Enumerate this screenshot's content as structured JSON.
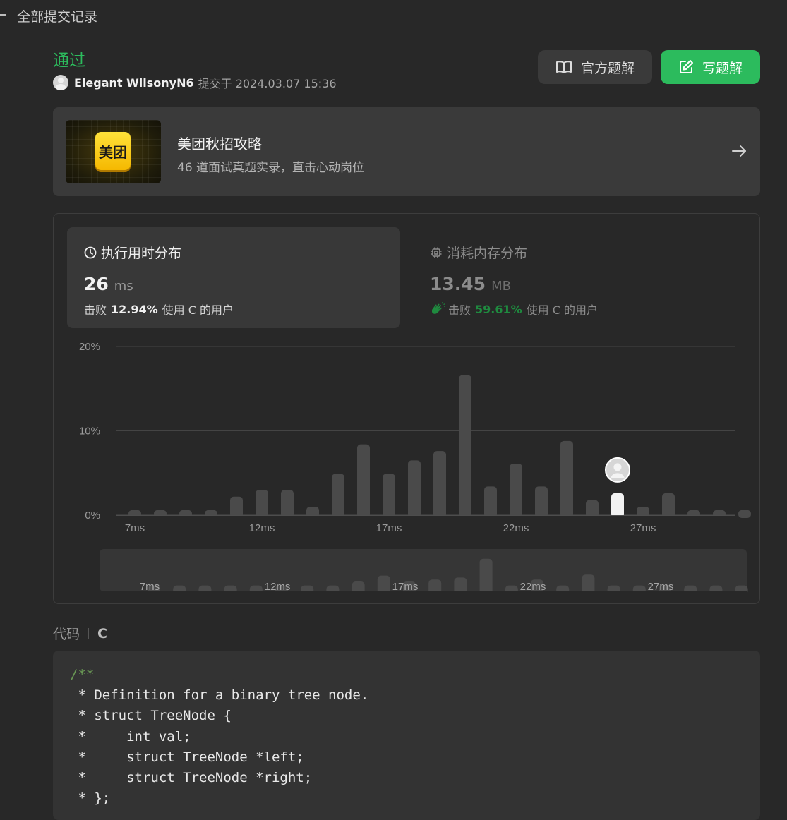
{
  "topbar": {
    "title": "全部提交记录"
  },
  "submission": {
    "status": "通过",
    "username": "Elegant WilsonyN6",
    "submitted_at": "提交于 2024.03.07 15:36"
  },
  "actions": {
    "official_solution": "官方题解",
    "write_solution": "写题解"
  },
  "promo": {
    "logo_text": "美团",
    "title": "美团秋招攻略",
    "subtitle": "46 道面试真题实录，直击心动岗位"
  },
  "runtime": {
    "label": "执行用时分布",
    "value": "26",
    "unit": "ms",
    "beats_prefix": "击败",
    "beats_pct": "12.94%",
    "beats_suffix": "使用 C 的用户"
  },
  "memory": {
    "label": "消耗内存分布",
    "value": "13.45",
    "unit": "MB",
    "beats_prefix": "击败",
    "beats_pct": "59.61%",
    "beats_suffix": "使用 C 的用户"
  },
  "chart_data": {
    "type": "bar",
    "x": [
      7,
      8,
      9,
      10,
      11,
      12,
      13,
      14,
      15,
      16,
      17,
      18,
      19,
      20,
      21,
      22,
      23,
      24,
      25,
      26,
      27,
      28,
      29,
      30,
      31
    ],
    "values": [
      0.6,
      0.6,
      0.6,
      0.6,
      2.2,
      3.0,
      3.0,
      1.0,
      4.9,
      8.4,
      4.9,
      6.5,
      7.6,
      16.6,
      3.4,
      6.1,
      3.4,
      8.8,
      1.8,
      2.6,
      1.0,
      2.6,
      0.6,
      0.6,
      0.6
    ],
    "x_ticks": [
      "7ms",
      "12ms",
      "17ms",
      "22ms",
      "27ms"
    ],
    "y_ticks": [
      "0%",
      "10%",
      "20%"
    ],
    "ylim": [
      0,
      20
    ],
    "highlight_x": 26,
    "grid": true,
    "mini_values": [
      0.6,
      0.6,
      0.6,
      0.6,
      0.6,
      0.6,
      0.6,
      0.6,
      1.0,
      1.6,
      1.0,
      1.2,
      1.4,
      3.3,
      0.6,
      1.2,
      0.6,
      1.7,
      0.6,
      0.6,
      0.6,
      0.6,
      0.6,
      0.6,
      0.6
    ]
  },
  "code": {
    "label": "代码",
    "language": "C",
    "comment_open": "/**",
    "lines": [
      " * Definition for a binary tree node.",
      " * struct TreeNode {",
      " *     int val;",
      " *     struct TreeNode *left;",
      " *     struct TreeNode *right;",
      " * };"
    ]
  },
  "colors": {
    "accent": "#2cbb5d",
    "background": "#282828",
    "card": "#3a3a3a",
    "bar": "#4a4a4a",
    "highlight": "#f2f2f2"
  }
}
